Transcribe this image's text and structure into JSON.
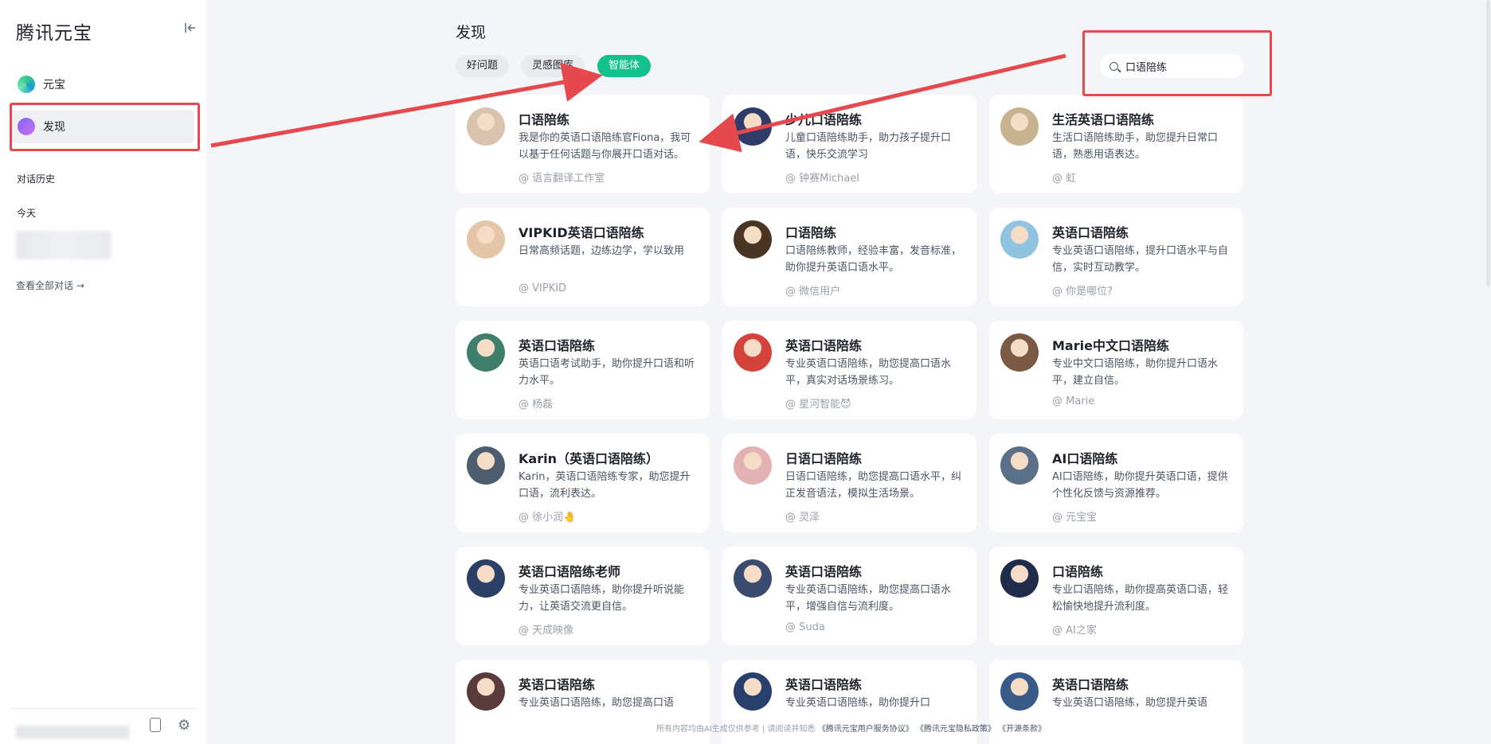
{
  "sidebar": {
    "brand": "腾讯元宝",
    "nav": [
      {
        "label": "元宝",
        "icon": "yuanbao-logo-icon"
      },
      {
        "label": "发现",
        "icon": "discover-sparkle-icon"
      }
    ],
    "history_label": "对话历史",
    "today_label": "今天",
    "view_all": "查看全部对话 →"
  },
  "main": {
    "title": "发现",
    "tabs": [
      {
        "label": "好问题",
        "active": false
      },
      {
        "label": "灵感图库",
        "active": false
      },
      {
        "label": "智能体",
        "active": true
      }
    ],
    "search_value": "口语陪练"
  },
  "cards": [
    {
      "name": "口语陪练",
      "desc": "我是你的英语口语陪练官Fiona，我可以基于任何话题与你展开口语对话。",
      "author": "@ 语言翻译工作室",
      "avatar_color": "#d9c3ae"
    },
    {
      "name": "少儿口语陪练",
      "desc": "儿童口语陪练助手，助力孩子提升口语，快乐交流学习",
      "author": "@ 钟赛Michael",
      "avatar_color": "#2f3c6a"
    },
    {
      "name": "生活英语口语陪练",
      "desc": "生活口语陪练助手，助您提升日常口语，熟悉用语表达。",
      "author": "@ 虹",
      "avatar_color": "#c9b28f"
    },
    {
      "name": "VIPKID英语口语陪练",
      "desc": "日常高频话题，边练边学，学以致用",
      "author": "@ VIPKID",
      "avatar_color": "#e6c6a8"
    },
    {
      "name": "口语陪练",
      "desc": "口语陪练教师，经验丰富，发音标准，助你提升英语口语水平。",
      "author": "@ 微信用户",
      "avatar_color": "#4a3424"
    },
    {
      "name": "英语口语陪练",
      "desc": "专业英语口语陪练，提升口语水平与自信，实时互动教学。",
      "author": "@ 你是哪位?",
      "avatar_color": "#8fc3e0"
    },
    {
      "name": "英语口语陪练",
      "desc": "英语口语考试助手，助你提升口语和听力水平。",
      "author": "@ 杨磊",
      "avatar_color": "#3e7f6c"
    },
    {
      "name": "英语口语陪练",
      "desc": "专业英语口语陪练，助您提高口语水平，真实对话场景练习。",
      "author": "@ 星河智能😈",
      "avatar_color": "#d4423c"
    },
    {
      "name": "Marie中文口语陪练",
      "desc": "专业中文口语陪练，助你提升口语水平，建立自信。",
      "author": "@ Marie",
      "avatar_color": "#7a5a44"
    },
    {
      "name": "Karin（英语口语陪练）",
      "desc": "Karin，英语口语陪练专家，助您提升口语，流利表达。",
      "author": "@ 徐小润🤚",
      "avatar_color": "#4b5d6e"
    },
    {
      "name": "日语口语陪练",
      "desc": "日语口语陪练，助您提高口语水平，纠正发音语法，模拟生活场景。",
      "author": "@ 灵泽",
      "avatar_color": "#e2b1b1"
    },
    {
      "name": "AI口语陪练",
      "desc": "AI口语陪练，助你提升英语口语，提供个性化反馈与资源推荐。",
      "author": "@ 元宝宝",
      "avatar_color": "#5a7088"
    },
    {
      "name": "英语口语陪练老师",
      "desc": "专业英语口语陪练，助你提升听说能力，让英语交流更自信。",
      "author": "@ 天成映像",
      "avatar_color": "#2c3f66"
    },
    {
      "name": "英语口语陪练",
      "desc": "专业英语口语陪练，助您提高口语水平，增强自信与流利度。",
      "author": "@ Suda",
      "avatar_color": "#3a4b70"
    },
    {
      "name": "口语陪练",
      "desc": "专业口语陪练，助你提高英语口语，轻松愉快地提升流利度。",
      "author": "@ AI之家",
      "avatar_color": "#1f2c4a"
    },
    {
      "name": "英语口语陪练",
      "desc": "专业英语口语陪练，助您提高口语",
      "author": "",
      "avatar_color": "#5a3a3a"
    },
    {
      "name": "英语口语陪练",
      "desc": "专业英语口语陪练，助你提升口",
      "author": "",
      "avatar_color": "#27406b"
    },
    {
      "name": "英语口语陪练",
      "desc": "专业英语口语陪练，助您提升英语",
      "author": "",
      "avatar_color": "#3a5a8a"
    }
  ],
  "footer": {
    "prefix": "所有内容均由AI生成仅供参考 | 请阅读并知悉",
    "link1": "《腾讯元宝用户服务协议》",
    "link2": "《腾讯元宝隐私政策》",
    "link3": "《开源条款》"
  },
  "colors": {
    "accent": "#12c28d",
    "annotation": "#e5484d",
    "background": "#f3f5f9"
  }
}
